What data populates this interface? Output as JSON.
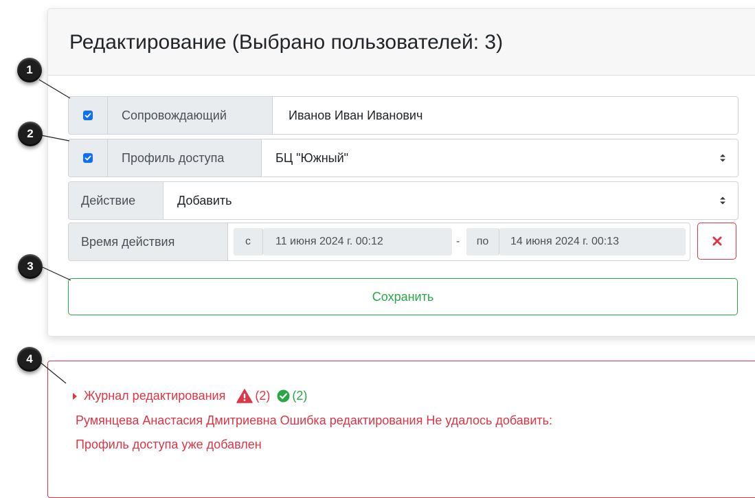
{
  "card": {
    "title": "Редактирование (Выбрано пользователей: 3)",
    "escort": {
      "checked": true,
      "label": "Сопровождающий",
      "value": "Иванов Иван Иванович"
    },
    "profile": {
      "checked": true,
      "label": "Профиль доступа",
      "value": "БЦ \"Южный\""
    },
    "action": {
      "label": "Действие",
      "value": "Добавить"
    },
    "time": {
      "label": "Время действия",
      "from_prefix": "с",
      "from_value": "11 июня 2024 г. 00:12",
      "separator": "-",
      "to_prefix": "по",
      "to_value": "14 июня 2024 г. 00:13"
    },
    "save_label": "Сохранить"
  },
  "log": {
    "title": "Журнал редактирования",
    "error_count": "(2)",
    "success_count": "(2)",
    "line1": "Румянцева Анастасия Дмитриевна Ошибка редактирования Не удалось добавить:",
    "line2": "Профиль доступа уже добавлен"
  },
  "callouts": [
    "1",
    "2",
    "3",
    "4"
  ],
  "icons": {
    "checkbox": "check-icon",
    "select": "select-arrows-icon",
    "clear": "close-icon",
    "warning": "warning-triangle-icon",
    "success": "check-circle-icon",
    "expand": "caret-right-icon"
  },
  "colors": {
    "checkbox": "#0d6efd",
    "danger": "#dc3545",
    "success": "#28a745",
    "addon_bg": "#e9ecef",
    "header_bg": "#f7f7f7",
    "badge": "#1e1e1e"
  }
}
